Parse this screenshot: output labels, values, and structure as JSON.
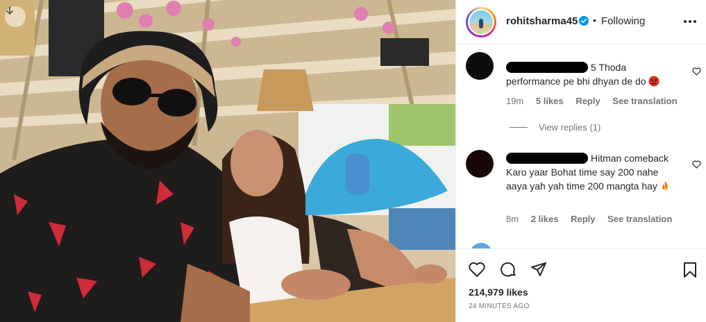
{
  "photo": {
    "description_icon": "arrow-down-icon"
  },
  "header": {
    "username": "rohitsharma45",
    "separator": "•",
    "follow_status": "Following",
    "verified_icon": "verified-badge-icon",
    "more_icon": "more-options-icon"
  },
  "comments": [
    {
      "text": "5 Thoda performance pe bhi dhyan de do",
      "emoji": "angry-face",
      "age": "19m",
      "likes": "5 likes",
      "reply": "Reply",
      "translate": "See translation"
    },
    {
      "text": "Hitman comeback Karo yaar Bohat time say 200 nahe aaya yah yah time 200 mangta hay",
      "emoji": "fire",
      "age": "8m",
      "likes": "2 likes",
      "reply": "Reply",
      "translate": "See translation"
    }
  ],
  "view_replies": "View replies (1)",
  "footer": {
    "likes": "214,979 likes",
    "time": "24 MINUTES AGO"
  },
  "colors": {
    "text": "#262626",
    "secondary": "#737373",
    "verified": "#0095f6",
    "divider": "#efefef"
  }
}
